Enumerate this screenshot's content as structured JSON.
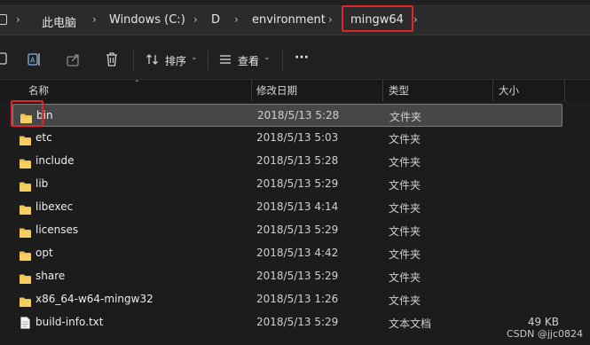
{
  "breadcrumb": {
    "items": [
      "此电脑",
      "Windows (C:)",
      "D",
      "environment",
      "mingw64"
    ],
    "separator": "›"
  },
  "toolbar": {
    "sort_label": "排序",
    "view_label": "查看",
    "more_label": "···"
  },
  "columns": {
    "name": "名称",
    "modified": "修改日期",
    "type": "类型",
    "size": "大小"
  },
  "files": [
    {
      "name": "bin",
      "modified": "2018/5/13 5:28",
      "type": "文件夹",
      "size": "",
      "kind": "folder",
      "selected": true
    },
    {
      "name": "etc",
      "modified": "2018/5/13 5:03",
      "type": "文件夹",
      "size": "",
      "kind": "folder"
    },
    {
      "name": "include",
      "modified": "2018/5/13 5:28",
      "type": "文件夹",
      "size": "",
      "kind": "folder"
    },
    {
      "name": "lib",
      "modified": "2018/5/13 5:29",
      "type": "文件夹",
      "size": "",
      "kind": "folder"
    },
    {
      "name": "libexec",
      "modified": "2018/5/13 4:14",
      "type": "文件夹",
      "size": "",
      "kind": "folder"
    },
    {
      "name": "licenses",
      "modified": "2018/5/13 5:29",
      "type": "文件夹",
      "size": "",
      "kind": "folder"
    },
    {
      "name": "opt",
      "modified": "2018/5/13 4:42",
      "type": "文件夹",
      "size": "",
      "kind": "folder"
    },
    {
      "name": "share",
      "modified": "2018/5/13 5:29",
      "type": "文件夹",
      "size": "",
      "kind": "folder"
    },
    {
      "name": "x86_64-w64-mingw32",
      "modified": "2018/5/13 1:26",
      "type": "文件夹",
      "size": "",
      "kind": "folder"
    },
    {
      "name": "build-info.txt",
      "modified": "2018/5/13 5:29",
      "type": "文本文档",
      "size": "49 KB",
      "kind": "text"
    }
  ],
  "watermark": "CSDN @jjc0824",
  "colors": {
    "highlight": "#e0262b",
    "folder": "#f2c14e",
    "background": "#1c1c1c"
  }
}
